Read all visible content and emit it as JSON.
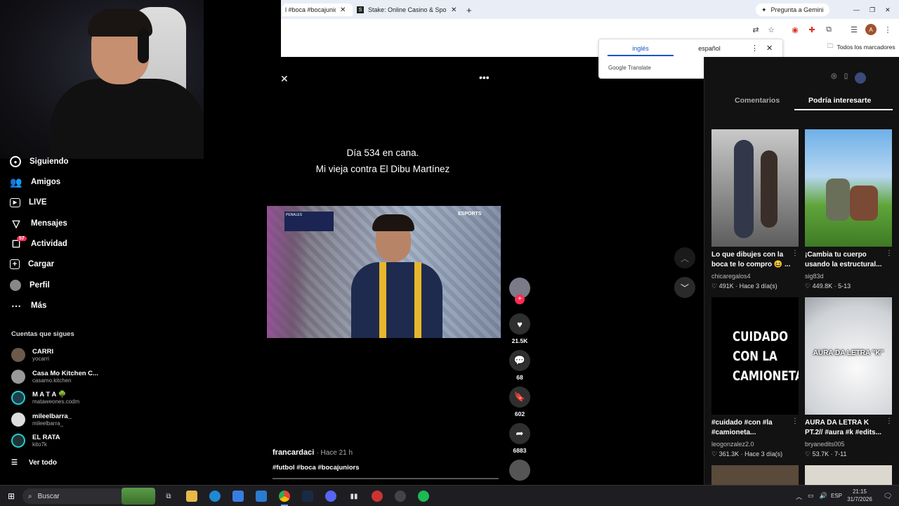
{
  "browser": {
    "tabs": [
      {
        "label": "l #boca #bocajunion"
      },
      {
        "label": "Stake: Online Casino & Sports B"
      }
    ],
    "gemini_label": "Pregunta a Gemini",
    "bookmarks_label": "Todos los marcadores"
  },
  "translate_popup": {
    "lang_from": "inglés",
    "lang_to": "español",
    "brand": "Google Translate"
  },
  "sidebar": {
    "items": [
      {
        "label": "Siguiendo",
        "icon": "following-icon"
      },
      {
        "label": "Amigos",
        "icon": "friends-icon"
      },
      {
        "label": "LIVE",
        "icon": "live-icon"
      },
      {
        "label": "Mensajes",
        "icon": "messages-icon"
      },
      {
        "label": "Actividad",
        "icon": "activity-icon",
        "badge": "57"
      },
      {
        "label": "Cargar",
        "icon": "upload-icon"
      },
      {
        "label": "Perfil",
        "icon": "profile-icon"
      },
      {
        "label": "Más",
        "icon": "more-icon"
      }
    ],
    "following_title": "Cuentas que sigues",
    "following": [
      {
        "name": "CARRI",
        "handle": "yocarri"
      },
      {
        "name": "Casa Mo Kitchen C...",
        "handle": "casamo.kitchen"
      },
      {
        "name": "M A T A 🌳",
        "handle": "mataweones.codm"
      },
      {
        "name": "mileelbarra_",
        "handle": "mileelbarra_"
      },
      {
        "name": "EL RATA",
        "handle": "kito7k"
      }
    ],
    "see_all": "Ver todo"
  },
  "video": {
    "caption_line1": "Día 534 en cana.",
    "caption_line2": "Mi vieja contra  El Dibu Martínez",
    "author": "francardaci",
    "time": "· Hace 21 h",
    "hashtags": "#futbol #boca #bocajuniors",
    "broadcaster": "ESPORTS",
    "score_label": "PENALES"
  },
  "actions": {
    "likes": "21.5K",
    "comments": "68",
    "saves": "602",
    "shares": "6883"
  },
  "right_panel": {
    "tabs": [
      "Comentarios",
      "Podría interesarte"
    ],
    "cards": [
      {
        "title": "Lo que dibujes con la boca te lo compro 😆 ...",
        "user": "chicaregalos4",
        "likes": "491K",
        "date": "· Hace 3 día(s)"
      },
      {
        "title": "¡Cambia tu cuerpo usando la estructural...",
        "user": "sig83d",
        "likes": "449.8K",
        "date": "· 5-13"
      },
      {
        "title": "#cuidado #con #la #camioneta...",
        "user": "leogonzalez2.0",
        "likes": "361.3K",
        "date": "· Hace 3 día(s)",
        "thumb_text": "CUIDADO CON LA CAMIONETA"
      },
      {
        "title": "AURA DA LETRA K PT.2// #aura #k #edits...",
        "user": "bryanedits005",
        "likes": "53.7K",
        "date": "· 7-11",
        "thumb_text": "AURA DA LETRA \"K\""
      }
    ]
  },
  "taskbar": {
    "search_placeholder": "Buscar",
    "lang": "ESP",
    "time": "21:15",
    "date": "31/7/2026"
  }
}
